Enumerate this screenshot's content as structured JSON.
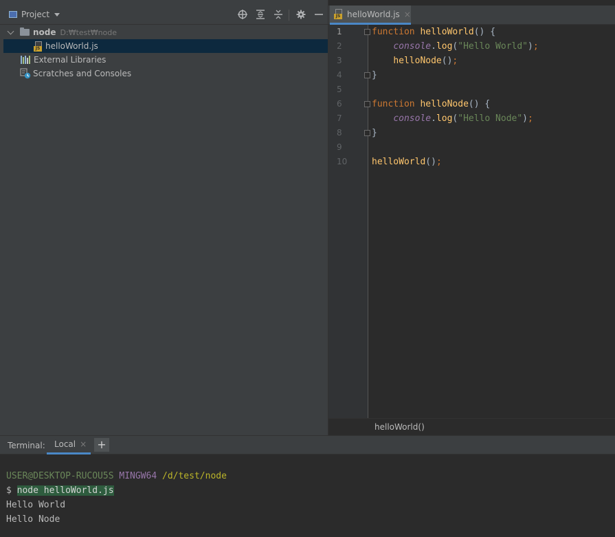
{
  "project_panel": {
    "title": "Project",
    "tree": {
      "root_name": "node",
      "root_path": "D:₩test₩node",
      "file": "helloWorld.js",
      "external_libraries": "External Libraries",
      "scratches": "Scratches and Consoles"
    }
  },
  "editor": {
    "tab_label": "helloWorld.js",
    "tab_close": "×",
    "line_numbers": [
      "1",
      "2",
      "3",
      "4",
      "5",
      "6",
      "7",
      "8",
      "9",
      "10"
    ],
    "code": {
      "kw_function": "function",
      "fn_helloWorld": "helloWorld",
      "fn_helloNode": "helloNode",
      "console": "console",
      "log": "log",
      "str_hello_world": "\"Hello World\"",
      "str_hello_node": "\"Hello Node\""
    },
    "breadcrumb": "helloWorld()"
  },
  "terminal": {
    "title": "Terminal:",
    "tab_label": "Local",
    "tab_close": "×",
    "add_label": "+",
    "prompt_user": "USER@DESKTOP-RUCOU5S",
    "prompt_system": "MINGW64",
    "prompt_path": "/d/test/node",
    "prompt_symbol": "$",
    "command": "node helloWorld.js",
    "output": [
      "Hello World",
      "Hello Node"
    ]
  },
  "colors": {
    "background": "#2b2b2b",
    "panel": "#3c3f41",
    "keyword": "#cc7832",
    "function": "#ffc66d",
    "string": "#6a8759",
    "object": "#9876aa",
    "selection": "#0d293e",
    "accent": "#4a88c7"
  }
}
